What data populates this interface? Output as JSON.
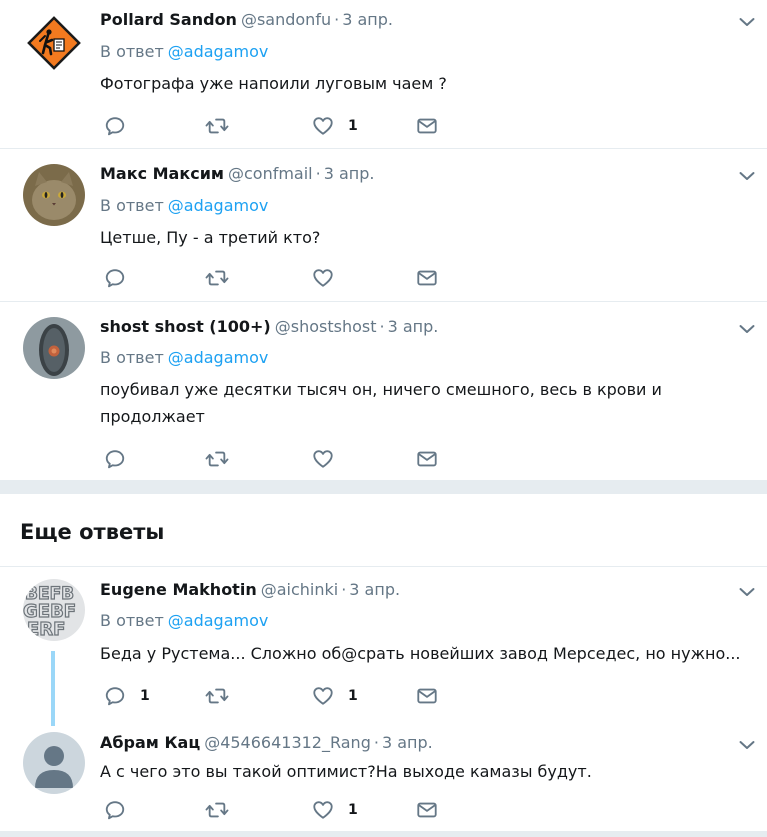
{
  "tweets": [
    {
      "name": "Pollard Sandon",
      "handle": "@sandonfu",
      "sep": "·",
      "time": "3 апр.",
      "reply_prefix": "В ответ",
      "reply_to": "@adagamov",
      "text": "Фотографа уже напоили луговым чаем ?",
      "reply_count": "",
      "retweet_count": "",
      "like_count": "1"
    },
    {
      "name": "Макс Максим",
      "handle": "@confmail",
      "sep": "·",
      "time": "3 апр.",
      "reply_prefix": "В ответ",
      "reply_to": "@adagamov",
      "text": "Цетше, Пу - а третий кто?",
      "reply_count": "",
      "retweet_count": "",
      "like_count": ""
    },
    {
      "name": "shost shost (100+)",
      "handle": "@shostshost",
      "sep": "·",
      "time": "3 апр.",
      "reply_prefix": "В ответ",
      "reply_to": "@adagamov",
      "text": "поубивал уже десятки тысяч он, ничего смешного, весь в крови и продолжает",
      "reply_count": "",
      "retweet_count": "",
      "like_count": ""
    }
  ],
  "more_replies": {
    "title": "Еще ответы",
    "tweets": [
      {
        "name": "Eugene Makhotin",
        "handle": "@aichinki",
        "sep": "·",
        "time": "3 апр.",
        "reply_prefix": "В ответ",
        "reply_to": "@adagamov",
        "text": "Беда у Рустема... Сложно об@срать новейших завод Мерседес, но нужно...",
        "reply_count": "1",
        "retweet_count": "",
        "like_count": "1"
      },
      {
        "name": "Абрам Кац",
        "handle": "@4546641312_Rang",
        "sep": "·",
        "time": "3 апр.",
        "text": "А с чего это вы такой оптимист?На выходе камазы будут.",
        "reply_count": "",
        "retweet_count": "",
        "like_count": "1"
      }
    ]
  },
  "colors": {
    "link": "#1da1f2",
    "muted": "#657786",
    "icon": "#657786",
    "divider": "#e6ecf0",
    "thread_line": "#9ad7f8"
  },
  "icons": {
    "reply": "reply-icon",
    "retweet": "retweet-icon",
    "like": "heart-icon",
    "dm": "envelope-icon",
    "more": "chevron-down-icon"
  }
}
